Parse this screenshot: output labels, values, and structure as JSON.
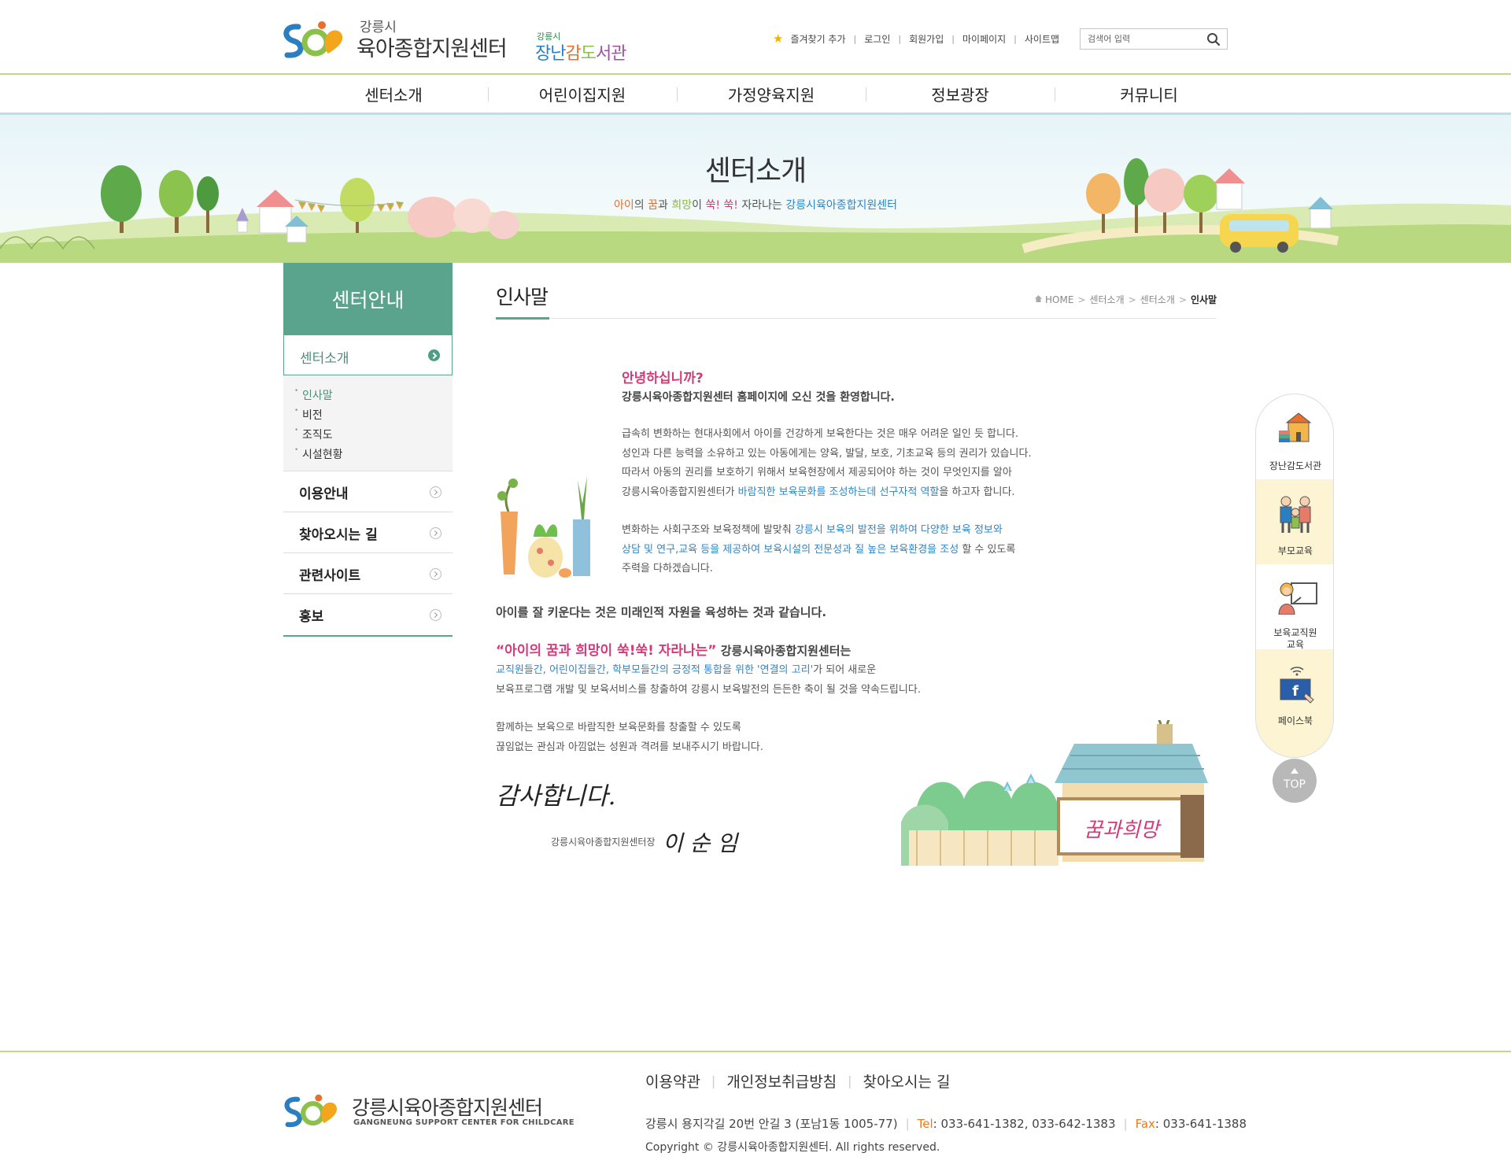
{
  "header": {
    "logo_sub": "강릉시",
    "logo_main": "육아종합지원센터",
    "library_sub": "강릉시",
    "library_main": [
      "장난",
      "감",
      "도",
      "서관"
    ],
    "util_links": [
      "즐겨찾기 추가",
      "로그인",
      "회원가입",
      "마이페이지",
      "사이트맵"
    ],
    "search_placeholder": "검색어 입력"
  },
  "gnb": [
    "센터소개",
    "어린이집지원",
    "가정양육지원",
    "정보광장",
    "커뮤니티"
  ],
  "banner": {
    "title": "센터소개",
    "sub": [
      "아이",
      "의 ",
      "꿈",
      "과 ",
      "희망",
      "이 ",
      "쑥! 쑥!",
      " 자라나는 ",
      "강릉시육아종합지원센터"
    ]
  },
  "lnb": {
    "head": "센터안내",
    "current": "센터소개",
    "sub_items": [
      "인사말",
      "비전",
      "조직도",
      "시설현황"
    ],
    "items": [
      "이용안내",
      "찾아오시는 길",
      "관련사이트",
      "홍보"
    ]
  },
  "content": {
    "title": "인사말",
    "breadcrumb": [
      "HOME",
      "센터소개",
      "센터소개",
      "인사말"
    ],
    "hello": "안녕하십니까?",
    "welcome": "강릉시육아종합지원센터 홈페이지에 오신 것을 환영합니다.",
    "p1_l1": "급속히 변화하는 현대사회에서 아이를 건강하게 보육한다는 것은 매우 어려운 일인 듯 합니다.",
    "p1_l2": "성인과 다른 능력을 소유하고 있는 아동에게는 양육, 발달, 보호, 기초교육 등의 권리가 있습니다.",
    "p1_l3": "따라서 아동의 권리를 보호하기 위해서 보육현장에서 제공되어야 하는 것이 무엇인지를 알아",
    "p1_l4a": "강릉시육아종합지원센터가 ",
    "p1_l4b": "바람직한 보육문화를 조성하는데 선구자적 역할",
    "p1_l4c": "을 하고자 합니다.",
    "p2_l1a": "변화하는 사회구조와 보육정책에 발맞춰 ",
    "p2_l1b": "강릉시 보육의 발전을 위하여 다양한 보육 정보와",
    "p2_l2a": "상담 및 연구,교육 등을 제공하여 보육시설의 전문성과 질 높은 보육환경을 조성",
    "p2_l2b": " 할 수 있도록",
    "p2_l3": "주력을 다하겠습니다.",
    "main_line": "아이를 잘 키운다는 것은 미래인적 자원을 육성하는 것과 같습니다.",
    "quote": "“아이의 꿈과 희망이 쑥!쑥! 자라나는”",
    "quote_rest": " 강릉시육아종합지원센터는",
    "p3_l1a": "교직원들간, 어린이집들간, 학부모들간의 긍정적 통합을 위한 '연결의 고리'",
    "p3_l1b": "가 되어 새로운",
    "p3_l2": "보육프로그램 개발 및 보육서비스를 창출하여 강릉시 보육발전의 든든한 축이 될 것을 약속드립니다.",
    "p4_l1": "함께하는 보육으로 바람직한 보육문화를 창출할 수 있도록",
    "p4_l2": "끊임없는 관심과 아낌없는 성원과 격려를 보내주시기 바랍니다.",
    "thanks": "감사합니다.",
    "sign_role": "강릉시육아종합지원센터장",
    "sign_name": "이 순 임",
    "sign_board": "꿈과희망"
  },
  "quick": [
    "장난감도서관",
    "부모교육",
    "보육교직원\n교육",
    "페이스북"
  ],
  "top_label": "TOP",
  "footer": {
    "links": [
      "이용약관",
      "개인정보취급방침",
      "찾아오시는 길"
    ],
    "logo_title": "강릉시육아종합지원센터",
    "logo_eng": "GANGNEUNG SUPPORT CENTER FOR CHILDCARE",
    "address": "강릉시 용지각길 20번 안길 3 (포남1동 1005-77)",
    "tel_label": "Tel",
    "tel": " : 033-641-1382, 033-642-1383",
    "fax_label": "Fax",
    "fax": " : 033-641-1388",
    "copyright": "Copyright © 강릉시육아종합지원센터. All rights reserved."
  },
  "colors": {
    "brand_green": "#5aa48e",
    "line_green": "#bcd98d",
    "pink": "#d23b79",
    "blue": "#2d86c9",
    "orange": "#e67c1e"
  }
}
